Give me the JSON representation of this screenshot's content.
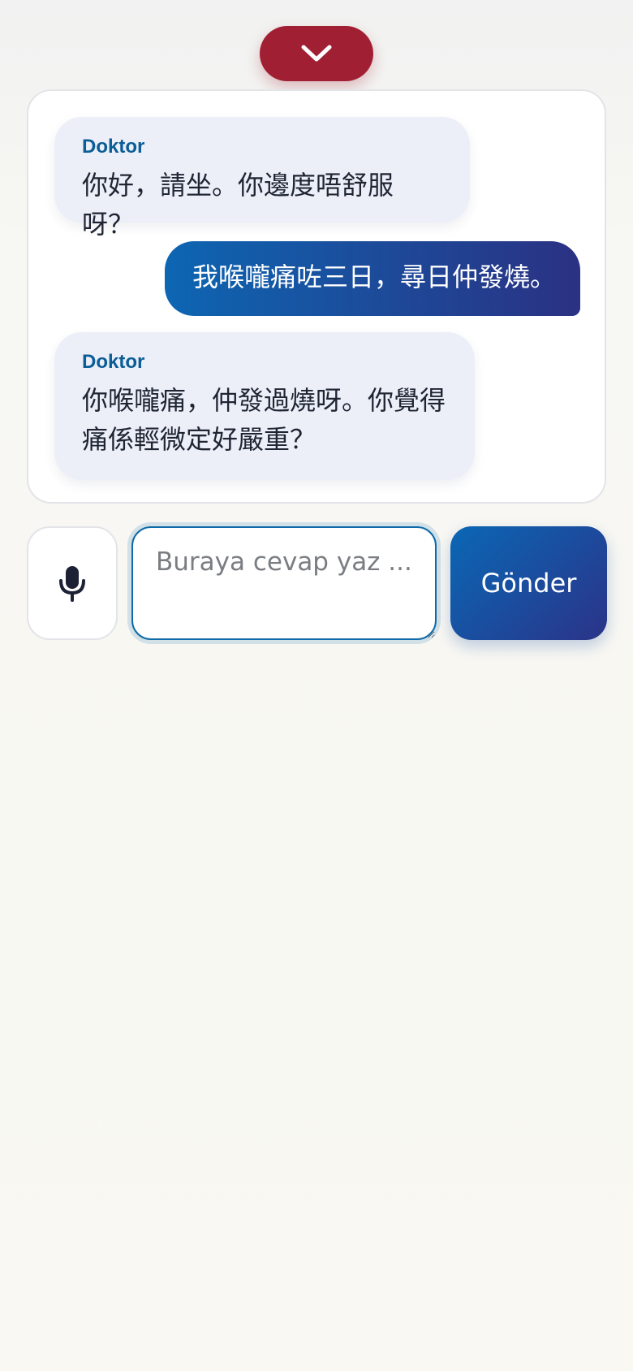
{
  "header": {
    "collapse_icon": "chevron-down-icon",
    "collapse_color": "#a11f33"
  },
  "chat": {
    "messages": [
      {
        "role": "doctor",
        "speaker": "Doktor",
        "text": "你好，請坐。你邊度唔舒服呀？"
      },
      {
        "role": "patient",
        "speaker": "",
        "text": "我喉嚨痛咗三日，尋日仲發燒。"
      },
      {
        "role": "doctor",
        "speaker": "Doktor",
        "text": "你喉嚨痛，仲發過燒呀。你覺得痛係輕微定好嚴重？"
      }
    ]
  },
  "composer": {
    "mic_icon": "microphone-icon",
    "input_value": "",
    "input_placeholder": "Buraya cevap yaz ...",
    "send_label": "Gönder",
    "accent_color": "#0d66b2"
  }
}
